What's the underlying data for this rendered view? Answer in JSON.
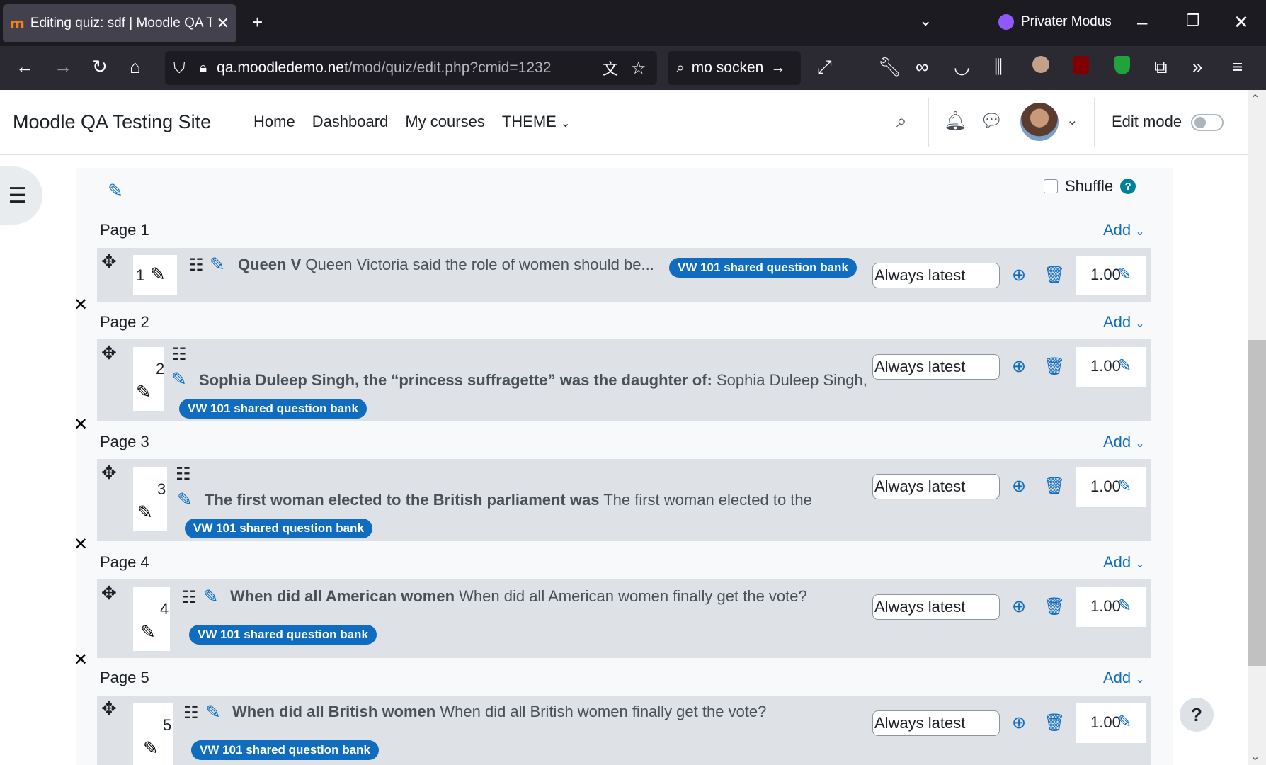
{
  "browser": {
    "tab_title": "Editing quiz: sdf | Moodle QA Te",
    "new_tab": "+",
    "private_label": "Privater Modus",
    "url_domain": "qa.moodledemo.net",
    "url_path": "/mod/quiz/edit.php?cmid=1232",
    "search_text": "mo socken"
  },
  "header": {
    "site_name": "Moodle QA Testing Site",
    "nav": [
      "Home",
      "Dashboard",
      "My courses",
      "THEME"
    ],
    "edit_mode": "Edit mode"
  },
  "quiz": {
    "shuffle_label": "Shuffle",
    "help_glyph": "?",
    "add_label": "Add",
    "version_label": "Always latest",
    "pages": [
      {
        "label": "Page 1",
        "number": "1",
        "title": "Queen V",
        "text": "Queen Victoria said the role of women should be...",
        "bank": "VW 101 shared question bank",
        "mark": "1.00"
      },
      {
        "label": "Page 2",
        "number": "2",
        "title": "Sophia Duleep Singh, the “princess suffragette” was the daughter of:",
        "text": "Sophia Duleep Singh,",
        "bank": "VW 101 shared question bank",
        "mark": "1.00"
      },
      {
        "label": "Page 3",
        "number": "3",
        "title": "The first woman elected to the British parliament was",
        "text": "The first woman elected to the",
        "bank": "VW 101 shared question bank",
        "mark": "1.00"
      },
      {
        "label": "Page 4",
        "number": "4",
        "title": "When did all American women",
        "text": "When did all American women finally get the vote?",
        "bank": "VW 101 shared question bank",
        "mark": "1.00"
      },
      {
        "label": "Page 5",
        "number": "5",
        "title": "When did all British women",
        "text": "When did all British women finally get the vote?",
        "bank": "VW 101 shared question bank",
        "mark": "1.00"
      }
    ]
  },
  "help_float": "?"
}
